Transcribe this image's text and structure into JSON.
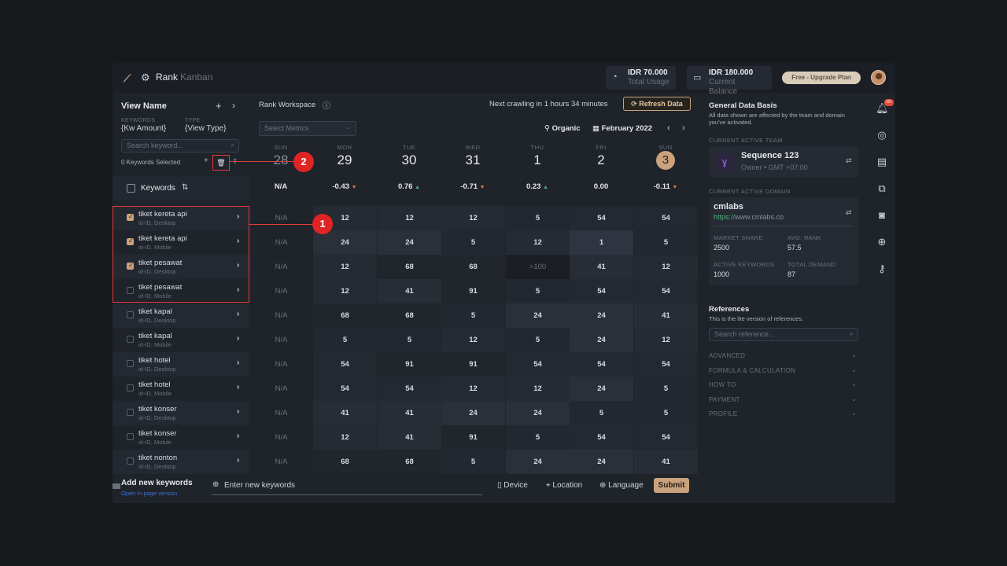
{
  "topbar": {
    "app_title": "Rank",
    "view_mode": "Kanban",
    "usage_value": "IDR 70.000",
    "usage_label": "Total Usage",
    "balance_value": "IDR 180.000",
    "balance_label": "Current Balance",
    "upgrade_label": "Free - Upgrade Plan"
  },
  "left": {
    "view_name": "View Name",
    "keywords_label": "KEYWORDS",
    "keywords_value": "{Kw Amount}",
    "type_label": "TYPE",
    "type_value": "{View Type}",
    "search_placeholder": "Search keyword...",
    "selected_count": "0 Keywords Selected",
    "header_label": "Keywords",
    "rows": [
      {
        "name": "tiket kereta api",
        "sub": "id-ID, Desktop",
        "checked": true
      },
      {
        "name": "tiket kereta api",
        "sub": "id-ID, Mobile",
        "checked": true
      },
      {
        "name": "tiket pesawat",
        "sub": "id-ID, Desktop",
        "checked": true
      },
      {
        "name": "tiket pesawat",
        "sub": "id-ID, Mobile",
        "checked": false
      },
      {
        "name": "tiket kapal",
        "sub": "id-ID, Desktop",
        "checked": false
      },
      {
        "name": "tiket kapal",
        "sub": "id-ID, Mobile",
        "checked": false
      },
      {
        "name": "tiket hotel",
        "sub": "id-ID, Desktop",
        "checked": false
      },
      {
        "name": "tiket hotel",
        "sub": "id-ID, Mobile",
        "checked": false
      },
      {
        "name": "tiket konser",
        "sub": "id-ID, Desktop",
        "checked": false
      },
      {
        "name": "tiket konser",
        "sub": "id-ID, Mobile",
        "checked": false
      },
      {
        "name": "tiket nonton",
        "sub": "id-ID, Desktop",
        "checked": false
      }
    ]
  },
  "center": {
    "workspace_title": "Rank Workspace",
    "crawl_text": "Next crawling in 1 hours 34 minutes",
    "refresh_label": "Refresh Data",
    "metrics_placeholder": "Select Metrics",
    "organic_label": "Organic",
    "month_label": "February 2022",
    "days": [
      {
        "dow": "SUN",
        "date": "28",
        "delta": "N/A",
        "trend": ""
      },
      {
        "dow": "MON",
        "date": "29",
        "delta": "-0.43",
        "trend": "down"
      },
      {
        "dow": "TUE",
        "date": "30",
        "delta": "0.76",
        "trend": "up"
      },
      {
        "dow": "WED",
        "date": "31",
        "delta": "-0.71",
        "trend": "down"
      },
      {
        "dow": "THU",
        "date": "1",
        "delta": "0.23",
        "trend": "up"
      },
      {
        "dow": "FRI",
        "date": "2",
        "delta": "0.00",
        "trend": ""
      },
      {
        "dow": "SUN",
        "date": "3",
        "delta": "-0.11",
        "trend": "down"
      }
    ],
    "grid": [
      [
        "N/A",
        "12",
        "12",
        "12",
        "5",
        "54",
        "54"
      ],
      [
        "N/A",
        "24",
        "24",
        "5",
        "12",
        "1",
        "5"
      ],
      [
        "N/A",
        "12",
        "68",
        "68",
        ">100",
        "41",
        "12"
      ],
      [
        "N/A",
        "12",
        "41",
        "91",
        "5",
        "54",
        "54"
      ],
      [
        "N/A",
        "68",
        "68",
        "5",
        "24",
        "24",
        "41"
      ],
      [
        "N/A",
        "5",
        "5",
        "12",
        "5",
        "24",
        "12"
      ],
      [
        "N/A",
        "54",
        "91",
        "91",
        "54",
        "54",
        "54"
      ],
      [
        "N/A",
        "54",
        "54",
        "12",
        "12",
        "24",
        "5"
      ],
      [
        "N/A",
        "41",
        "41",
        "24",
        "24",
        "5",
        "5"
      ],
      [
        "N/A",
        "12",
        "41",
        "91",
        "5",
        "54",
        "54"
      ],
      [
        "N/A",
        "68",
        "68",
        "5",
        "24",
        "24",
        "41"
      ]
    ]
  },
  "right": {
    "basis_title": "General Data Basis",
    "basis_desc": "All data shown are affected by the team and domain you've activated.",
    "team_label": "CURRENT ACTIVE TEAM",
    "team_name": "Sequence 123",
    "team_sub": "Owner • GMT +07:00",
    "domain_label": "CURRENT ACTIVE DOMAIN",
    "domain_name": "cmlabs",
    "domain_url_scheme": "https://",
    "domain_url_rest": "www.cmlabs.co",
    "market_share_label": "MARKET SHARE",
    "market_share_value": "2500",
    "avg_rank_label": "AVG. RANK",
    "avg_rank_value": "57.5",
    "active_kw_label": "ACTIVE KEYWORDS",
    "active_kw_value": "1000",
    "total_demand_label": "TOTAL DEMAND",
    "total_demand_value": "87",
    "refs_title": "References",
    "refs_desc": "This is the lite version of references.",
    "refs_placeholder": "Search reference...",
    "sections": [
      "ADVANCED",
      "FORMULA & CALCULATION",
      "HOW TO",
      "PAYMENT",
      "PROFILE"
    ]
  },
  "rail": {
    "notif_badge": "10+"
  },
  "bottom": {
    "add_title": "Add new keywords",
    "open_link": "Open in page version",
    "input_placeholder": "Enter new keywords",
    "device_label": "Device",
    "location_label": "Location",
    "language_label": "Language",
    "submit_label": "Submit"
  },
  "annotations": {
    "marker1": "1",
    "marker2": "2"
  },
  "colors": {
    "accent": "#c9a27d",
    "annotation": "#e23b3b",
    "up": "#4fae7a",
    "down": "#d4804a"
  }
}
